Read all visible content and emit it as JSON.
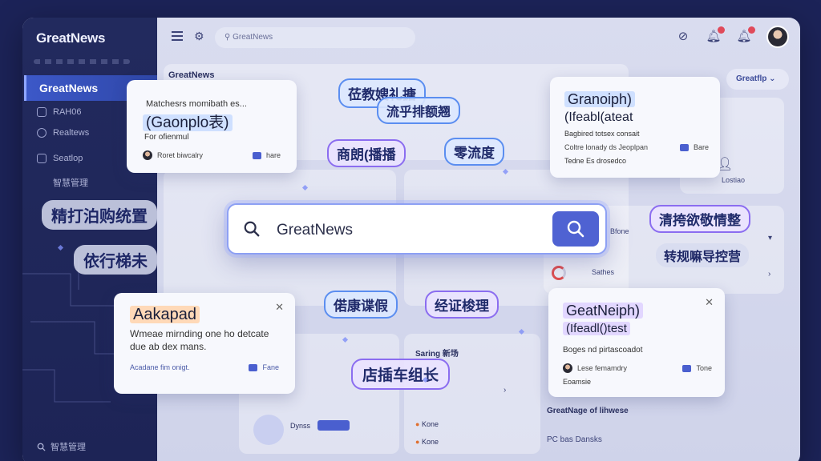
{
  "sidebar": {
    "brand": "GreatNews",
    "active": "GreatNews",
    "items": [
      "RAH06",
      "Realtews",
      "Seatlop",
      "智慧管理"
    ],
    "bottom": "智慧管理"
  },
  "topbar": {
    "search_placeholder": "GreatNews"
  },
  "main": {
    "bg_title": "GreatNews",
    "dropdown": "Greatflp",
    "bg_texts": [
      "Lostiao",
      "Bfone",
      "Sathes",
      "Saring 新场",
      "Dynss",
      "Kone",
      "Kone",
      "GreatNage of lihwese",
      "PC bas Dansks"
    ]
  },
  "search": {
    "value": "GreatNews"
  },
  "cards": [
    {
      "lines": [
        "Matchesrs momibath es...",
        "(Gaonplo表)",
        "For ofienmul"
      ],
      "meta": "Roret biwcalry",
      "action": "hare"
    },
    {
      "lines": [
        "Granoiph)",
        "(Ifeabl(ateat",
        "Bagbired totsex consait",
        "Coltre lonady ds Jeoplpan",
        "Tedne Es drosedco"
      ],
      "action": "Bare"
    },
    {
      "lines": [
        "Aakapad",
        "Wmeae mirnding one ho detcate",
        "due ab dex mans."
      ],
      "meta": "Acadane fim onigt.",
      "action": "Fane"
    },
    {
      "lines": [
        "GeatNeiph)",
        "(Ifeadl()test",
        "Boges nd pirtascoadot"
      ],
      "meta": "Lese femamdry",
      "sub": "Eoamsie",
      "action": "Tone"
    }
  ],
  "labels": [
    "莅教嫂礼搪",
    "流乎排额翘",
    "商朗(播播",
    "零流度",
    "精打泊购统置",
    "依行梯未",
    "偌康谍假",
    "经证梭理",
    "店插车组长",
    "清挎欲敬情整",
    "转规嘛导控营"
  ],
  "colors": {
    "accent": "#4f62d2",
    "sidebar": "#222a5e"
  }
}
